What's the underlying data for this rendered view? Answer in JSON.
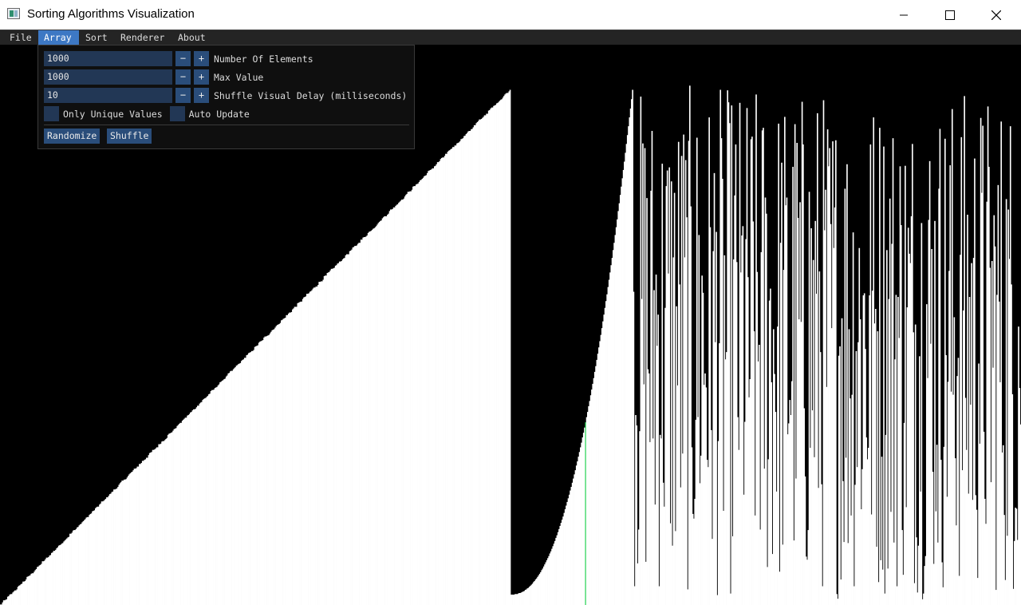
{
  "window": {
    "title": "Sorting Algorithms Visualization"
  },
  "menu": {
    "items": [
      "File",
      "Array",
      "Sort",
      "Renderer",
      "About"
    ],
    "active": "Array"
  },
  "array_popup": {
    "fields": [
      {
        "value": "1000",
        "label": "Number Of Elements"
      },
      {
        "value": "1000",
        "label": "Max Value"
      },
      {
        "value": "10",
        "label": "Shuffle Visual Delay (milliseconds)"
      }
    ],
    "minus_label": "−",
    "plus_label": "+",
    "only_unique_label": "Only Unique Values",
    "only_unique_checked": false,
    "auto_update_label": "Auto Update",
    "auto_update_checked": false,
    "randomize_label": "Randomize",
    "shuffle_label": "Shuffle"
  },
  "visualization": {
    "element_count": 1000,
    "max_value": 1000,
    "bar_color": "#ffffff",
    "background_color": "#000000",
    "highlight_color": "#2fd35a",
    "sorted_fraction": 0.5,
    "highlight_index": 573
  }
}
